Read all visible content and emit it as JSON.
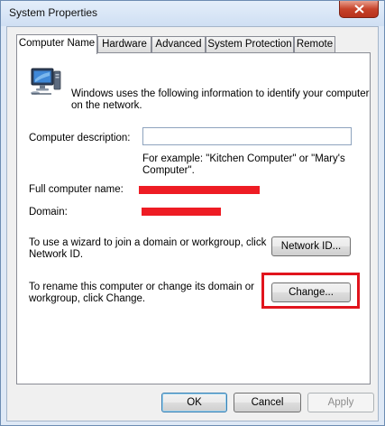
{
  "window": {
    "title": "System Properties"
  },
  "tabs": [
    {
      "label": "Computer Name",
      "active": true
    },
    {
      "label": "Hardware",
      "active": false
    },
    {
      "label": "Advanced",
      "active": false
    },
    {
      "label": "System Protection",
      "active": false
    },
    {
      "label": "Remote",
      "active": false
    }
  ],
  "computer_name": {
    "intro_line1": "Windows uses the following information to identify your computer",
    "intro_line2": "on the network.",
    "description_label": "Computer description:",
    "description_value": "",
    "example_line1": "For example: \"Kitchen Computer\" or \"Mary's",
    "example_line2": "Computer\".",
    "full_name_label": "Full computer name:",
    "domain_label": "Domain:",
    "network_text_line1": "To use a wizard to join a domain or workgroup, click",
    "network_text_line2": "Network ID.",
    "network_id_button": "Network ID...",
    "rename_text_line1": "To rename this computer or change its domain or",
    "rename_text_line2": "workgroup, click Change.",
    "change_button": "Change..."
  },
  "footer": {
    "ok_button": "OK",
    "cancel_button": "Cancel",
    "apply_button": "Apply"
  },
  "colors": {
    "redaction": "#ee1c24",
    "highlight": "#e1141d",
    "window_frame": "#dfe9f6",
    "close_button": "#c7432a"
  },
  "icons": {
    "computer": "computer-monitor-icon",
    "close": "close-x-icon"
  }
}
